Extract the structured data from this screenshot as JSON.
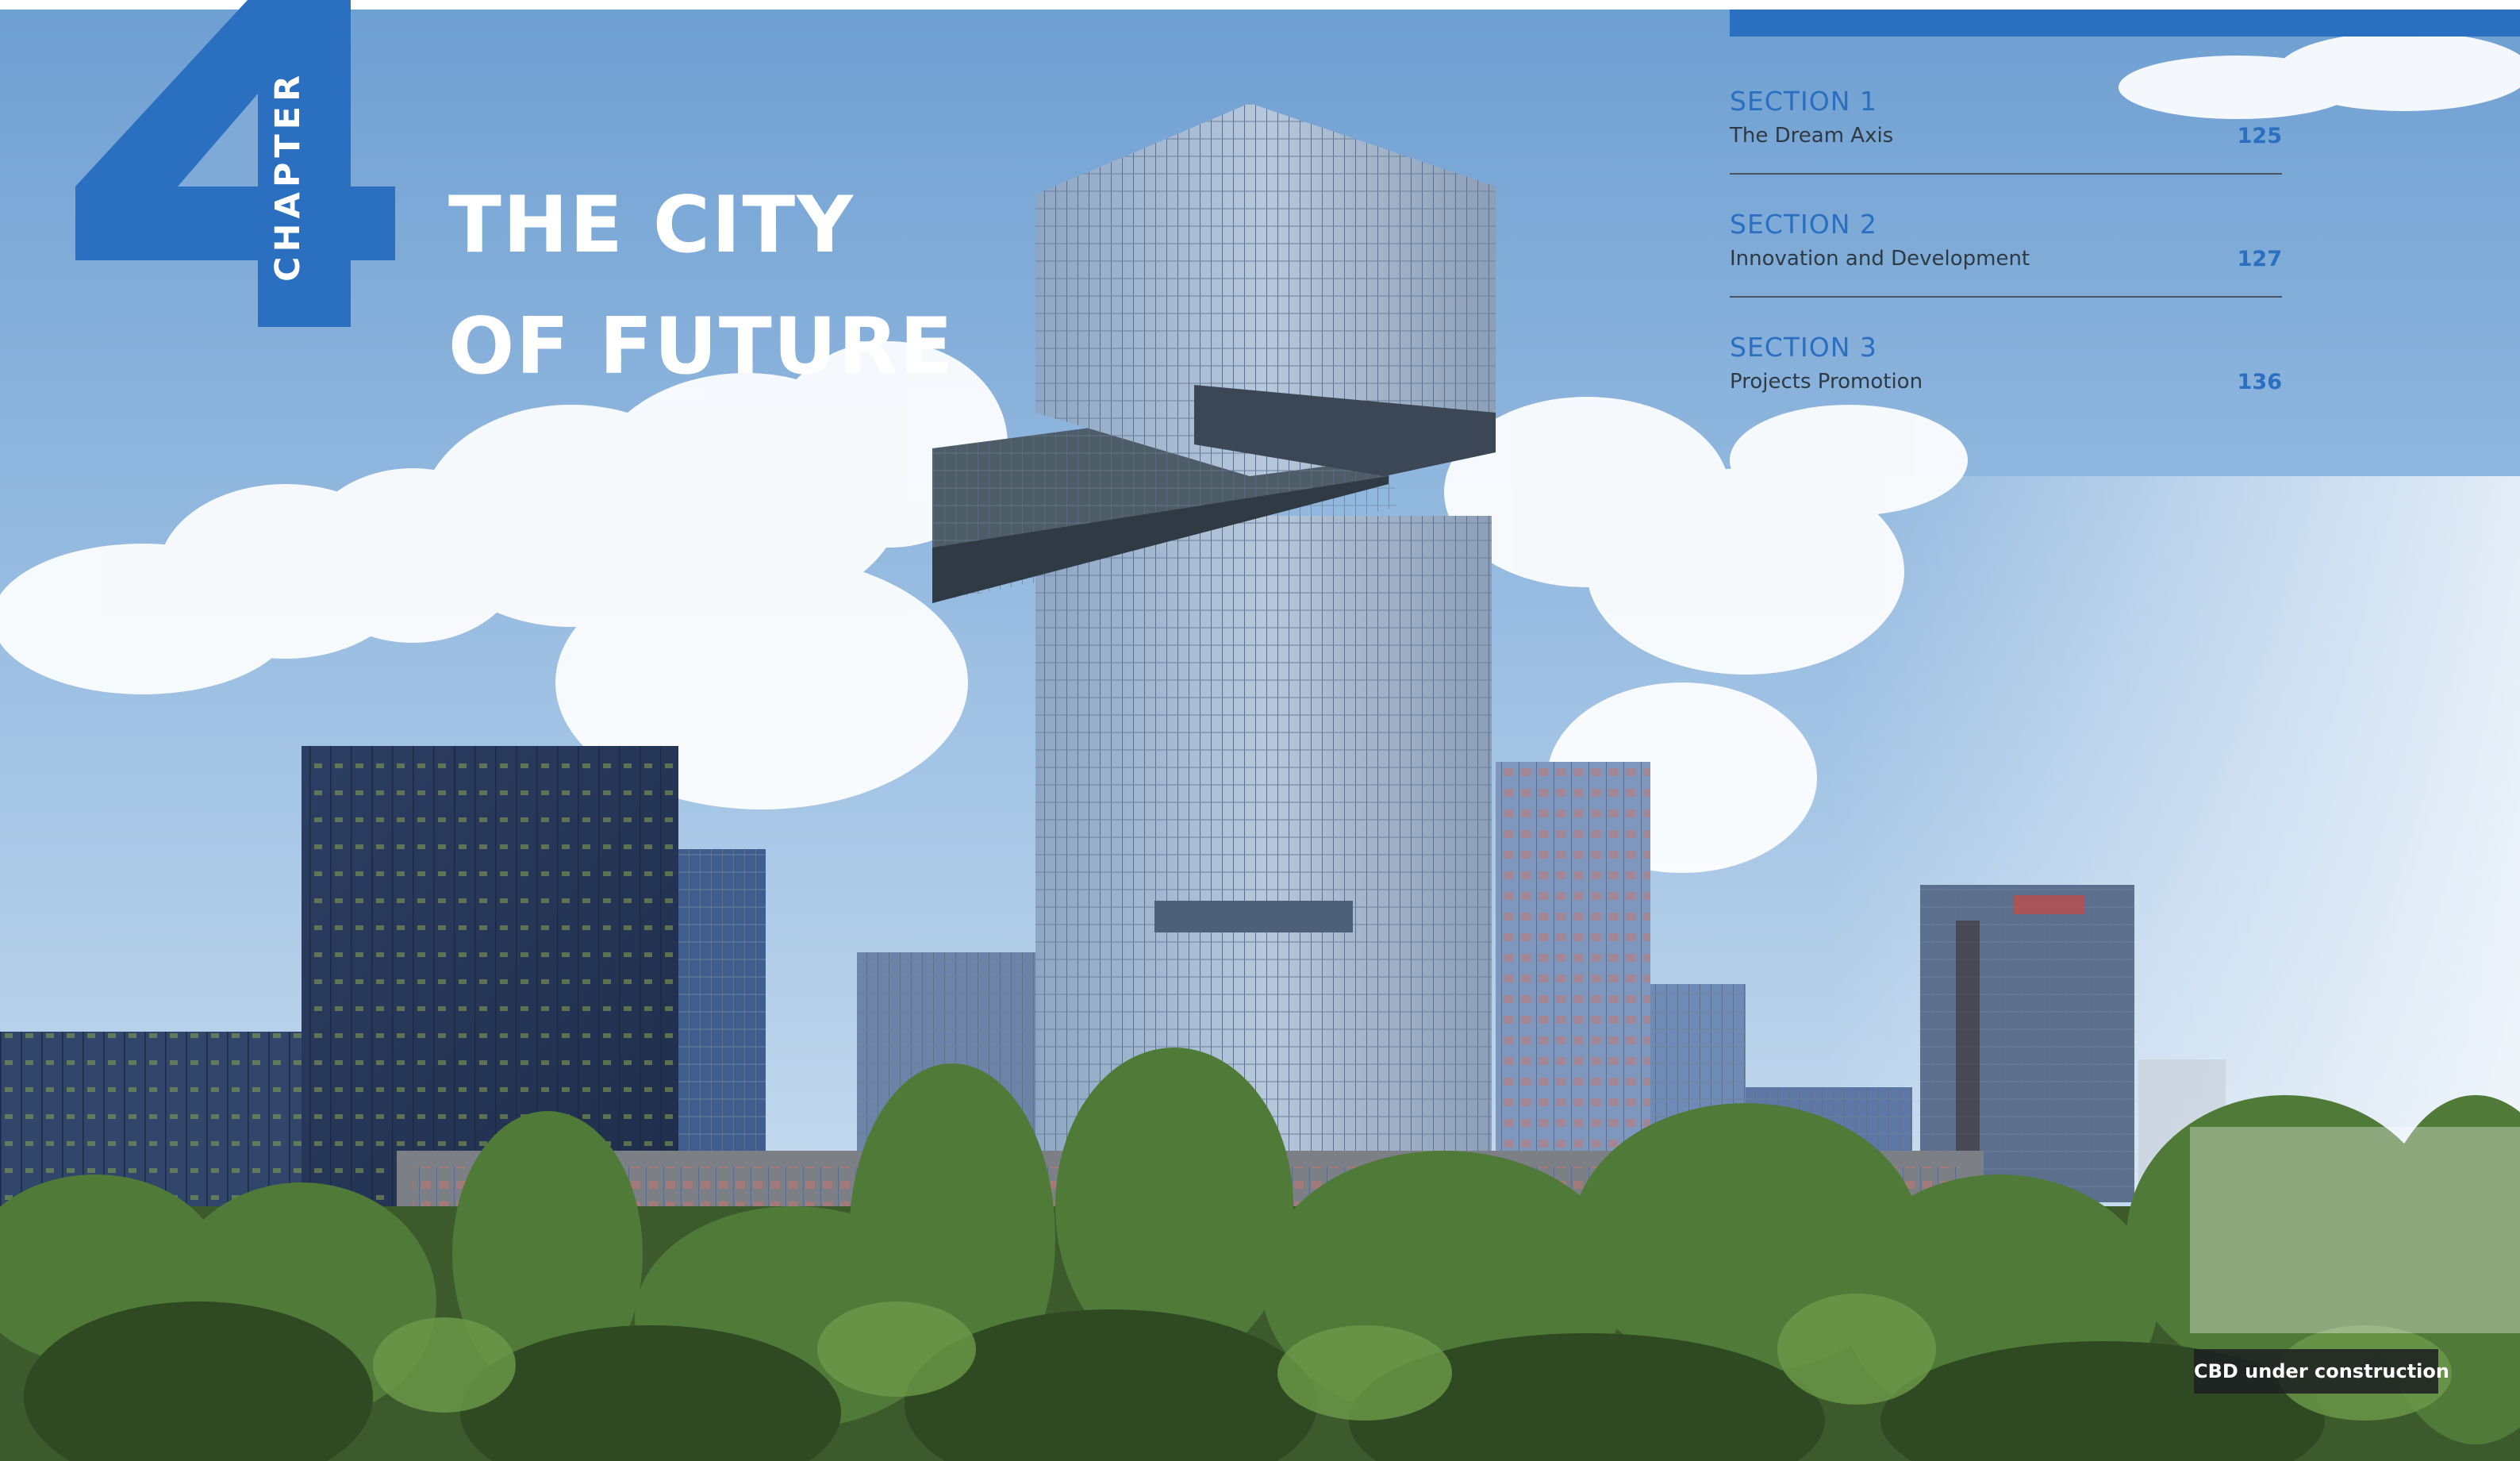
{
  "chapter": {
    "number": "4",
    "label": "CHAPTER"
  },
  "title": {
    "line1": "THE CITY",
    "line2": "OF FUTURE"
  },
  "toc": [
    {
      "section": "SECTION 1",
      "name": "The Dream Axis",
      "page": "125"
    },
    {
      "section": "SECTION 2",
      "name": "Innovation and Development",
      "page": "127"
    },
    {
      "section": "SECTION 3",
      "name": "Projects Promotion",
      "page": "136"
    }
  ],
  "caption": "CBD under construction",
  "colors": {
    "accent": "#2a6fc0",
    "sky": "#8ab3dc",
    "foliage": "#3f6a2e"
  }
}
